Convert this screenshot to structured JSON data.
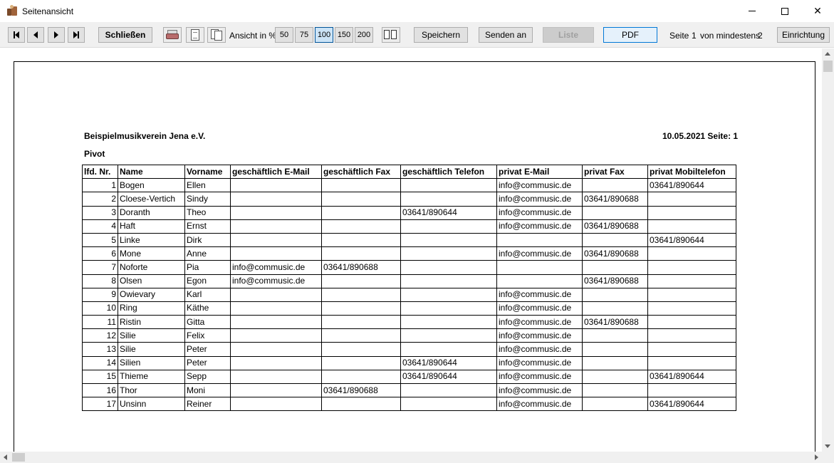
{
  "window": {
    "title": "Seitenansicht"
  },
  "toolbar": {
    "close_label": "Schließen",
    "zoom_label": "Ansicht in %",
    "zoom_options": [
      "50",
      "75",
      "100",
      "150",
      "200"
    ],
    "zoom_selected": "100",
    "save_label": "Speichern",
    "send_label": "Senden an",
    "list_label": "Liste",
    "pdf_label": "PDF",
    "page_label": "Seite",
    "page_current": "1",
    "page_of_label": "von mindestens",
    "page_total": "2",
    "setup_label": "Einrichtung"
  },
  "report": {
    "org": "Beispielmusikverein Jena e.V.",
    "date_page": "10.05.2021 Seite: 1",
    "subtitle": "Pivot",
    "columns": [
      "lfd. Nr.",
      "Name",
      "Vorname",
      "geschäftlich E-Mail",
      "geschäftlich Fax",
      "geschäftlich Telefon",
      "privat E-Mail",
      "privat Fax",
      "privat Mobiltelefon"
    ],
    "rows": [
      [
        "1",
        "Bogen",
        "Ellen",
        "",
        "",
        "",
        "info@commusic.de",
        "",
        "03641/890644"
      ],
      [
        "2",
        "Cloese-Vertich",
        "Sindy",
        "",
        "",
        "",
        "info@commusic.de",
        "03641/890688",
        ""
      ],
      [
        "3",
        "Doranth",
        "Theo",
        "",
        "",
        "03641/890644",
        "info@commusic.de",
        "",
        ""
      ],
      [
        "4",
        "Haft",
        "Ernst",
        "",
        "",
        "",
        "info@commusic.de",
        "03641/890688",
        ""
      ],
      [
        "5",
        "Linke",
        "Dirk",
        "",
        "",
        "",
        "",
        "",
        "03641/890644"
      ],
      [
        "6",
        "Mone",
        "Anne",
        "",
        "",
        "",
        "info@commusic.de",
        "03641/890688",
        ""
      ],
      [
        "7",
        "Noforte",
        "Pia",
        "info@commusic.de",
        "03641/890688",
        "",
        "",
        "",
        ""
      ],
      [
        "8",
        "Olsen",
        "Egon",
        "info@commusic.de",
        "",
        "",
        "",
        "03641/890688",
        ""
      ],
      [
        "9",
        "Owievary",
        "Karl",
        "",
        "",
        "",
        "info@commusic.de",
        "",
        ""
      ],
      [
        "10",
        "Ring",
        "Käthe",
        "",
        "",
        "",
        "info@commusic.de",
        "",
        ""
      ],
      [
        "11",
        "Ristin",
        "Gitta",
        "",
        "",
        "",
        "info@commusic.de",
        "03641/890688",
        ""
      ],
      [
        "12",
        "Silie",
        "Felix",
        "",
        "",
        "",
        "info@commusic.de",
        "",
        ""
      ],
      [
        "13",
        "Silie",
        "Peter",
        "",
        "",
        "",
        "info@commusic.de",
        "",
        ""
      ],
      [
        "14",
        "Silien",
        "Peter",
        "",
        "",
        "03641/890644",
        "info@commusic.de",
        "",
        ""
      ],
      [
        "15",
        "Thieme",
        "Sepp",
        "",
        "",
        "03641/890644",
        "info@commusic.de",
        "",
        "03641/890644"
      ],
      [
        "16",
        "Thor",
        "Moni",
        "",
        "03641/890688",
        "",
        "info@commusic.de",
        "",
        ""
      ],
      [
        "17",
        "Unsinn",
        "Reiner",
        "",
        "",
        "",
        "info@commusic.de",
        "",
        "03641/890644"
      ]
    ]
  },
  "icons": {
    "app": "app-icon",
    "first": "first-page-icon",
    "prev": "prev-page-icon",
    "next": "next-page-icon",
    "last": "last-page-icon",
    "print": "printer-icon",
    "single_page": "single-page-icon",
    "two_pages": "two-pages-icon",
    "multi_pages": "multi-pages-icon"
  },
  "colors": {
    "toolbar_bg": "#f0f0f0",
    "button_bg": "#e1e1e1",
    "active_zoom_bg": "#cce4f7",
    "pdf_border": "#0078d7"
  }
}
